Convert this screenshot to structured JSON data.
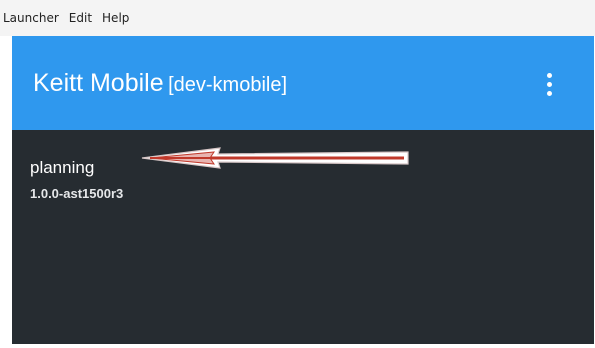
{
  "menubar": {
    "items": [
      {
        "label": "Launcher"
      },
      {
        "label": "Edit"
      },
      {
        "label": "Help"
      }
    ]
  },
  "appbar": {
    "title": "Keitt Mobile",
    "environment": "[dev-kmobile]",
    "color": "#2f98ee",
    "overflow_icon": "more-vert-icon"
  },
  "apps": [
    {
      "name": "planning",
      "version": "1.0.0-ast1500r3"
    }
  ],
  "colors": {
    "window_background": "#262c31",
    "annotation_arrow": "#c0392b"
  }
}
